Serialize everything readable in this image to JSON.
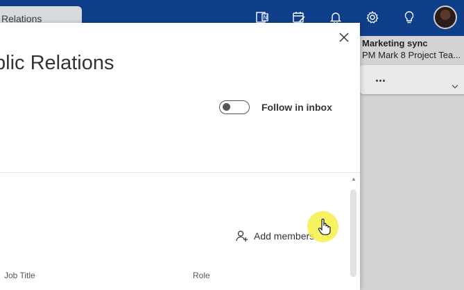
{
  "topbar": {
    "tab_label": "Relations",
    "icons": [
      "onenote-icon",
      "calendar-edit-icon",
      "bell-icon",
      "gear-icon",
      "lightbulb-icon"
    ],
    "avatar": "user-avatar",
    "bg_color": "#0f3f8a"
  },
  "background_event": {
    "title": "Marketing sync",
    "subtitle": "PM Mark 8 Project Tea...",
    "more": "..."
  },
  "panel": {
    "title": "blic Relations",
    "follow_label": "Follow in inbox",
    "follow_enabled": false,
    "add_members_label": "Add members",
    "columns": [
      "Job Title",
      "Role"
    ]
  }
}
